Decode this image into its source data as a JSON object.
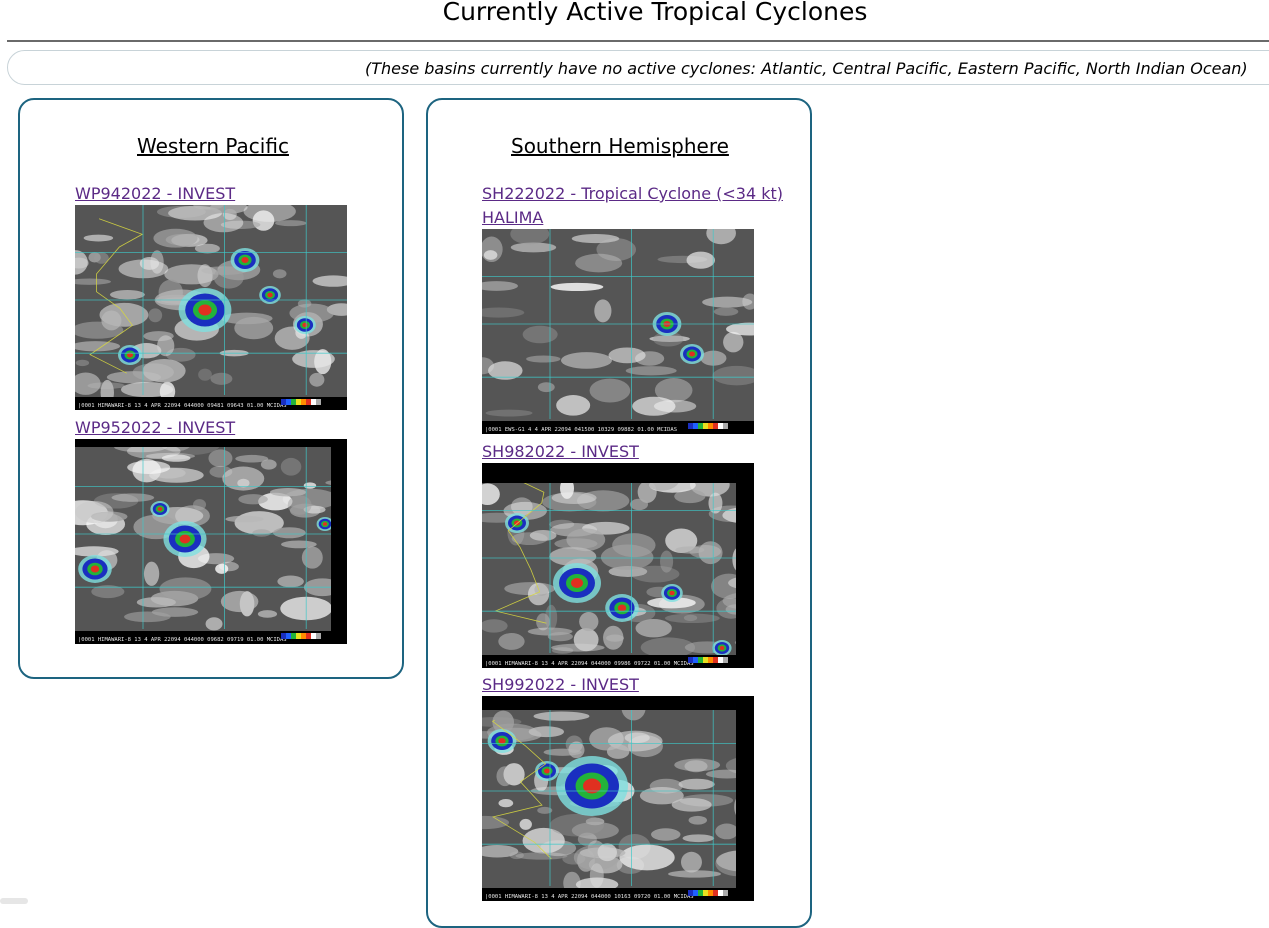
{
  "page": {
    "title": "Currently Active Tropical Cyclones",
    "notice": "(These basins currently have no active cyclones: Atlantic, Central Pacific, Eastern Pacific, North Indian Ocean)"
  },
  "basins": [
    {
      "title": "Western Pacific",
      "storms": [
        {
          "link_label": "WP942022 - INVEST",
          "image_caption": "|0001 HIMAWARI-8 13  4 APR 22094 044000 09481 09643 01.00   MCIDAS"
        },
        {
          "link_label": "WP952022 - INVEST",
          "image_caption": "|0001 HIMAWARI-8 13  4 APR 22094 044000 09682 09719 01.00   MCIDAS"
        }
      ]
    },
    {
      "title": "Southern Hemisphere",
      "storms": [
        {
          "link_label_line1": "SH222022 - Tropical Cyclone (<34 kt)",
          "link_label_line2": "HALIMA",
          "image_caption": "|0001 EWS-G1  4  4 APR 22094 041500 10329 09882 01.00   MCIDAS"
        },
        {
          "link_label": "SH982022 - INVEST",
          "image_caption": "|0001 HIMAWARI-8 13  4 APR 22094 044000 09986 09722 01.00   MCIDAS"
        },
        {
          "link_label": "SH992022 - INVEST",
          "image_caption": "|0001 HIMAWARI-8 13  4 APR 22094 044000 10163 09720 01.00   MCIDAS"
        }
      ]
    }
  ],
  "colors": {
    "panel_border": "#1d6480",
    "link": "#5b2a86",
    "grid_lines": "#3fc9c9",
    "coastlines": "#d6d640"
  }
}
